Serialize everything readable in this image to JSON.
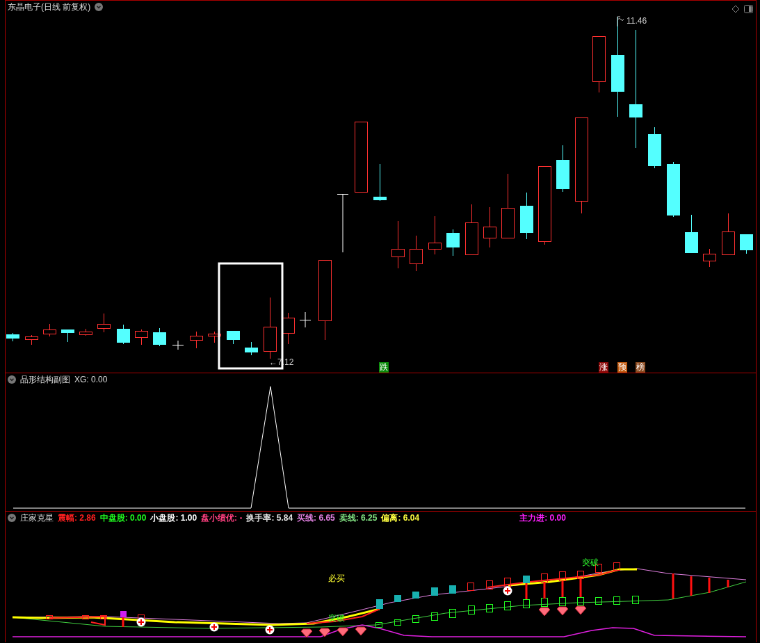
{
  "main": {
    "title": "东晶电子(日线 前复权)",
    "high_label": "11.46",
    "low_label": "←7.12",
    "markers": [
      {
        "text": "跌",
        "color": "#0a8a0a"
      },
      {
        "text": "涨",
        "color": "#8b0a0a"
      },
      {
        "text": "预",
        "color": "#c05a10"
      },
      {
        "text": "榜",
        "color": "#8b4a20"
      }
    ]
  },
  "sub": {
    "title": "品形结构副图",
    "reading": "XG: 0.00"
  },
  "bottom": {
    "title": "庄家克星",
    "readings": [
      {
        "text": "震幅: 2.86",
        "color": "#ff2020"
      },
      {
        "text": "中盘股: 0.00",
        "color": "#20ff20"
      },
      {
        "text": "小盘股: 1.00",
        "color": "#ffffff"
      },
      {
        "text": "盘小绩优: -",
        "color": "#ff4080"
      },
      {
        "text": "换手率: 5.84",
        "color": "#e0e0e0"
      },
      {
        "text": "买线: 6.65",
        "color": "#e080e0"
      },
      {
        "text": "卖线: 6.25",
        "color": "#80e080"
      },
      {
        "text": "偏离: 6.04",
        "color": "#ffff40"
      },
      {
        "text": "主力进: 0.00",
        "color": "#ff20ff"
      }
    ],
    "labels": [
      {
        "text": "必买",
        "kind": "buy"
      },
      {
        "text": "突破",
        "kind": "break"
      },
      {
        "text": "突破",
        "kind": "break"
      }
    ]
  }
}
